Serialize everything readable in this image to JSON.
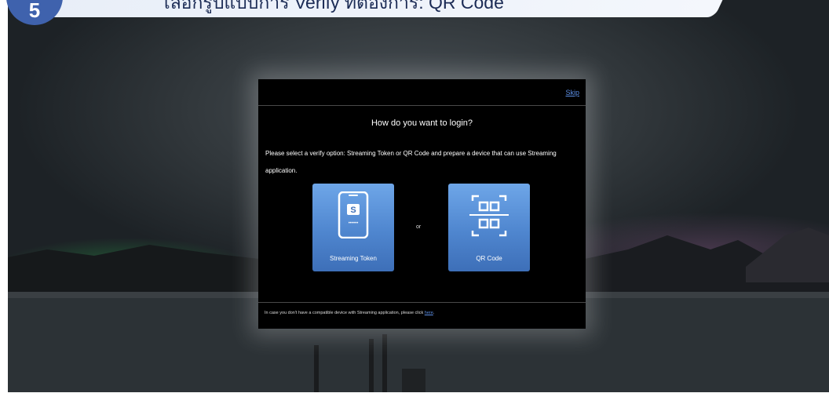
{
  "step": {
    "number": "5",
    "title": "ไลอกรูปแบบการ Verify ที่ต้องการ: QR Code"
  },
  "dialog": {
    "skip_label": "Skip",
    "title": "How do you want to login?",
    "instruction": "Please select a verify option: Streaming Token or QR Code and prepare a device that can use Streaming application.",
    "options": [
      {
        "label": "Streaming Token",
        "icon": "phone-token-icon"
      },
      {
        "label": "QR Code",
        "icon": "qr-code-icon"
      }
    ],
    "separator": "or",
    "footer_text": "In case you don't have a compatible device with Streaming application, please click",
    "footer_link": "here",
    "footer_end": "."
  },
  "colors": {
    "tile_blue": "#4f86cf",
    "link_blue": "#5c8fe6",
    "badge_blue": "#3f62ad"
  }
}
